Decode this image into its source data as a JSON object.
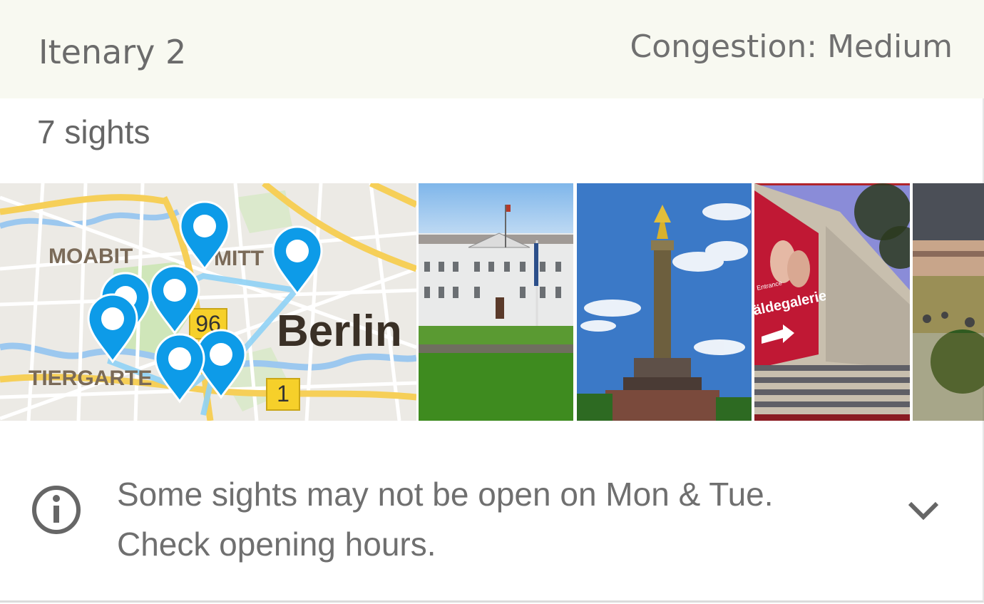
{
  "itinerary": {
    "title": "Itenary 2",
    "congestion": "Congestion: Medium",
    "sights_count": "7 sights"
  },
  "map": {
    "labels": {
      "area1": "MOABIT",
      "area2": "MITT",
      "area3": "TIERGARTE",
      "city": "Berlin"
    },
    "road_shields": [
      "96",
      "1"
    ]
  },
  "photos": [
    {
      "name": "Schloss Bellevue"
    },
    {
      "name": "Victory Column"
    },
    {
      "name": "Gemäldegalerie",
      "banner_small": "Entrance",
      "banner_big": "äldegalerie"
    },
    {
      "name": "Park"
    }
  ],
  "notice": {
    "line1": "Some sights may not be open on Mon & Tue.",
    "line2": "Check opening hours."
  },
  "icons": {
    "info": "info-circle-icon",
    "expand": "chevron-down-icon"
  },
  "colors": {
    "pin": "#0d9be8",
    "route": "#8fd2f5",
    "text": "#6f6f6f",
    "header_bg": "#f8f9f1"
  }
}
